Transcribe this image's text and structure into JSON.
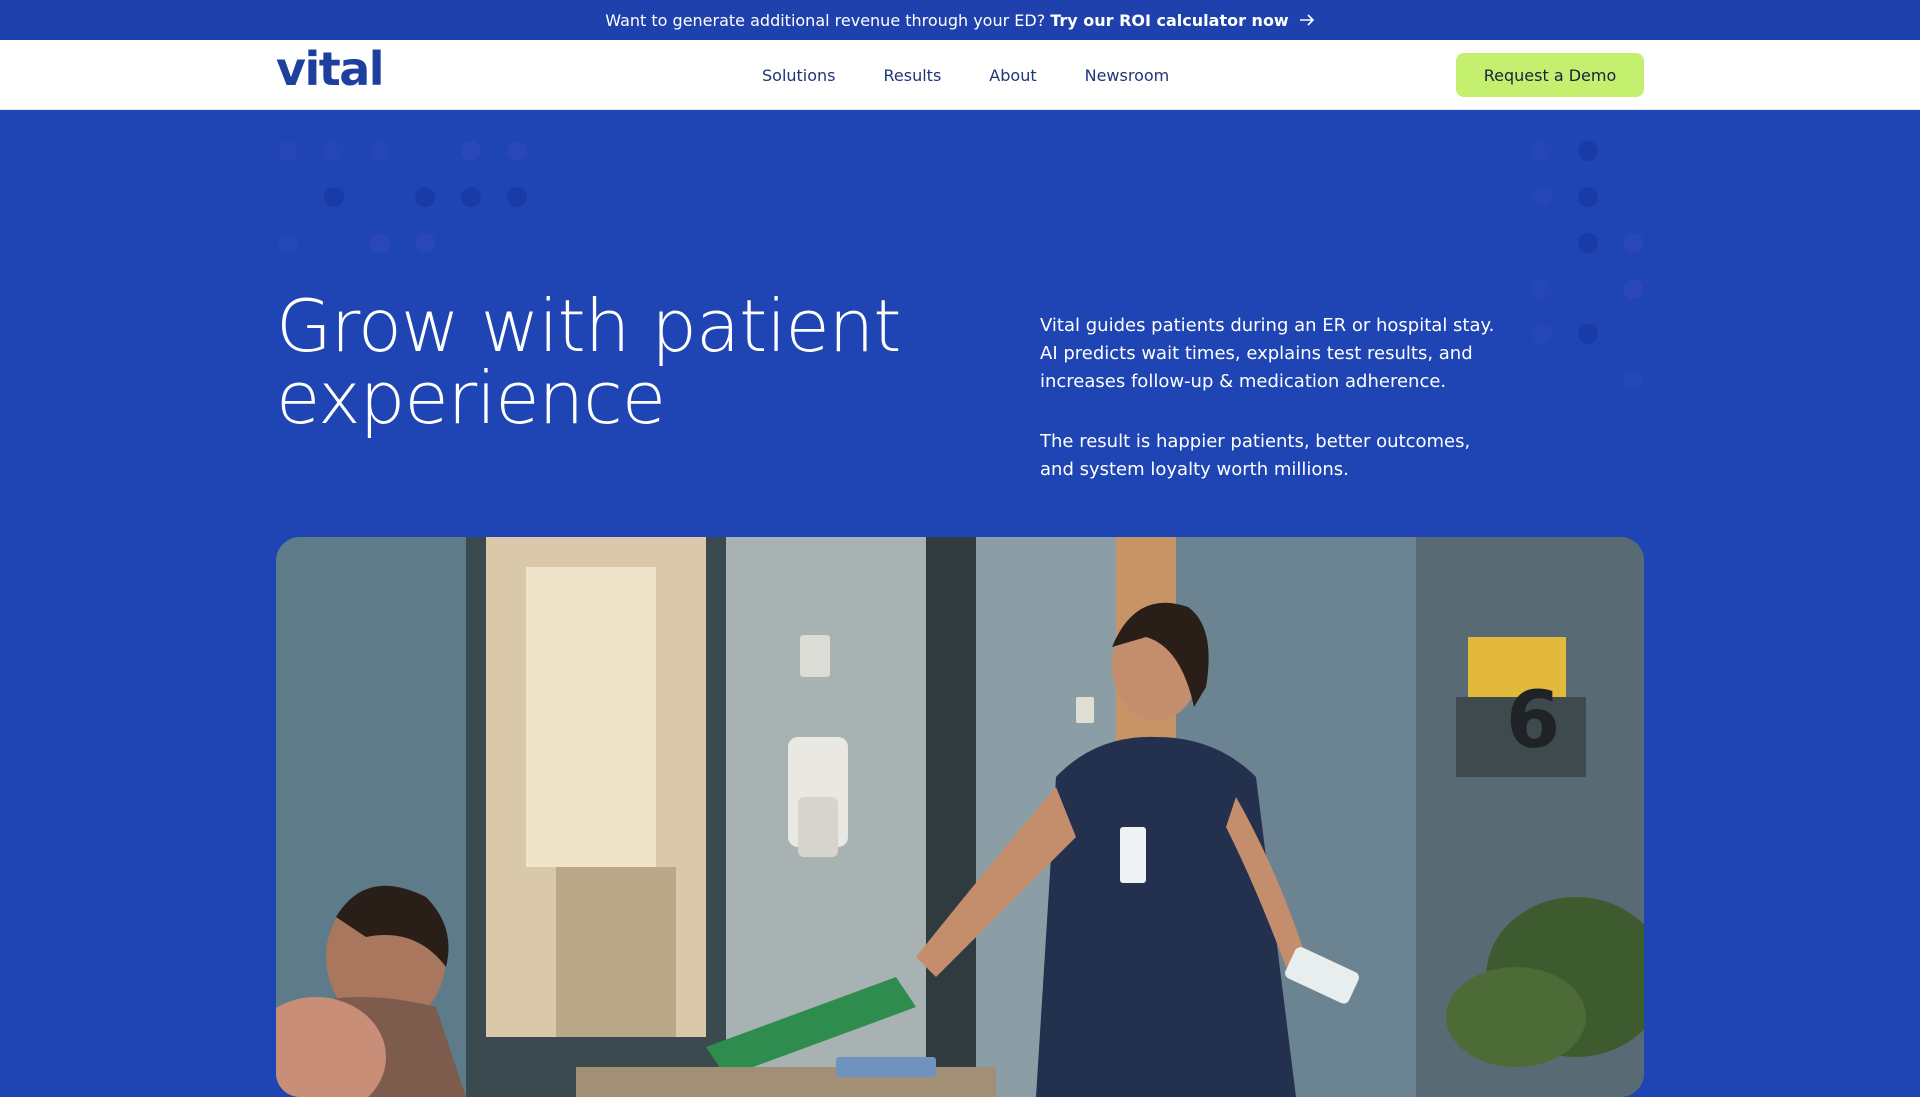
{
  "announcement": {
    "text": "Want to generate additional revenue through your ED?",
    "link_label": "Try our ROI calculator now",
    "link_icon": "arrow-right-icon"
  },
  "header": {
    "logo_text": "vital",
    "nav": [
      "Solutions",
      "Results",
      "About",
      "Newsroom"
    ],
    "cta_label": "Request a Demo"
  },
  "hero": {
    "title": "Grow with patient experience",
    "paragraph_1": "Vital guides patients during an ER or hospital stay. AI predicts wait times, explains test results, and increases follow-up & medication adherence.",
    "paragraph_2": "The result is happier patients, better outcomes, and system loyalty worth millions."
  },
  "media": {
    "sign_number": "6"
  },
  "colors": {
    "brand_blue": "#1f45b4",
    "banner_blue": "#1f41ad",
    "cta_green": "#c5ef6e",
    "nav_text": "#1f3577"
  }
}
